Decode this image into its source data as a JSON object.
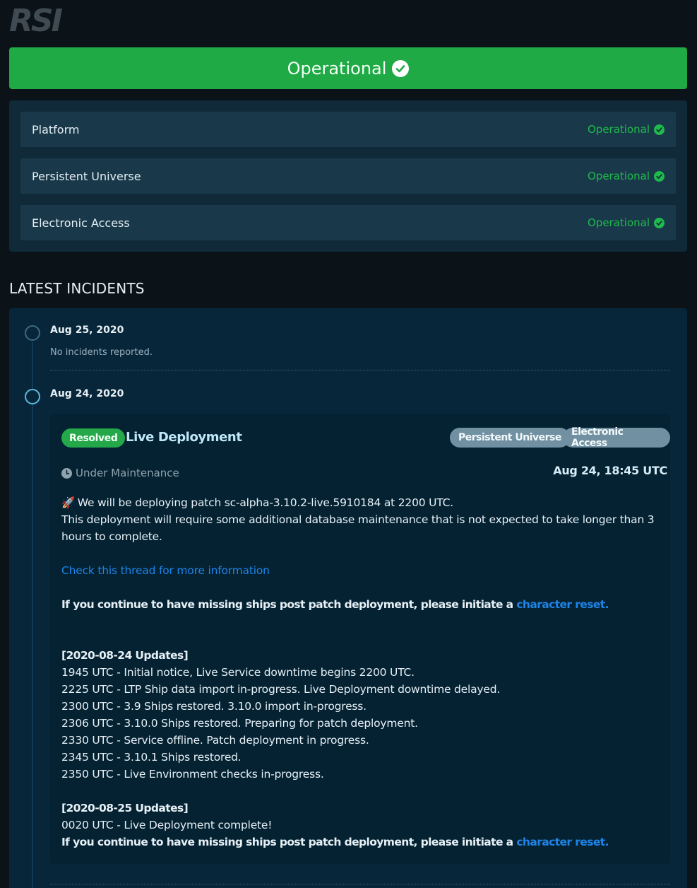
{
  "logo": {
    "text": "RSI"
  },
  "overall": {
    "label": "Operational",
    "color": "#1faa45"
  },
  "systems": [
    {
      "name": "Platform",
      "status": "Operational"
    },
    {
      "name": "Persistent Universe",
      "status": "Operational"
    },
    {
      "name": "Electronic Access",
      "status": "Operational"
    }
  ],
  "incidents_heading": "LATEST INCIDENTS",
  "days": [
    {
      "date": "Aug 25, 2020",
      "note": "No incidents reported."
    },
    {
      "date": "Aug 24, 2020"
    }
  ],
  "incident": {
    "status": "Resolved",
    "title": "Live Deployment",
    "tags": [
      "Persistent Universe",
      "Electronic Access"
    ],
    "state": "Under Maintenance",
    "time": "Aug 24, 18:45 UTC",
    "rocket": "🚀",
    "line1": " We will be deploying patch sc-alpha-3.10.2-live.5910184 at 2200 UTC.",
    "line2": "This deployment will require some additional database maintenance that is not expected to take longer than 3 hours to complete.",
    "thread_link": "Check this thread for more information",
    "missing_ships": "If you continue to have missing ships post patch deployment, please initiate a ",
    "char_reset": "character reset.",
    "updates1_heading": "[2020-08-24 Updates]",
    "updates1": [
      "1945 UTC - Initial notice, Live Service downtime begins 2200 UTC.",
      "2225 UTC - LTP Ship data import in-progress. Live Deployment downtime delayed.",
      "2300 UTC - 3.9 Ships restored. 3.10.0 import in-progress.",
      "2306 UTC - 3.10.0 Ships restored. Preparing for patch deployment.",
      "2330 UTC - Service offline. Patch deployment in progress.",
      "2345 UTC - 3.10.1 Ships restored.",
      "2350 UTC - Live Environment checks in-progress."
    ],
    "updates2_heading": "[2020-08-25 Updates]",
    "updates2": [
      "0020 UTC - Live Deployment complete!"
    ]
  }
}
